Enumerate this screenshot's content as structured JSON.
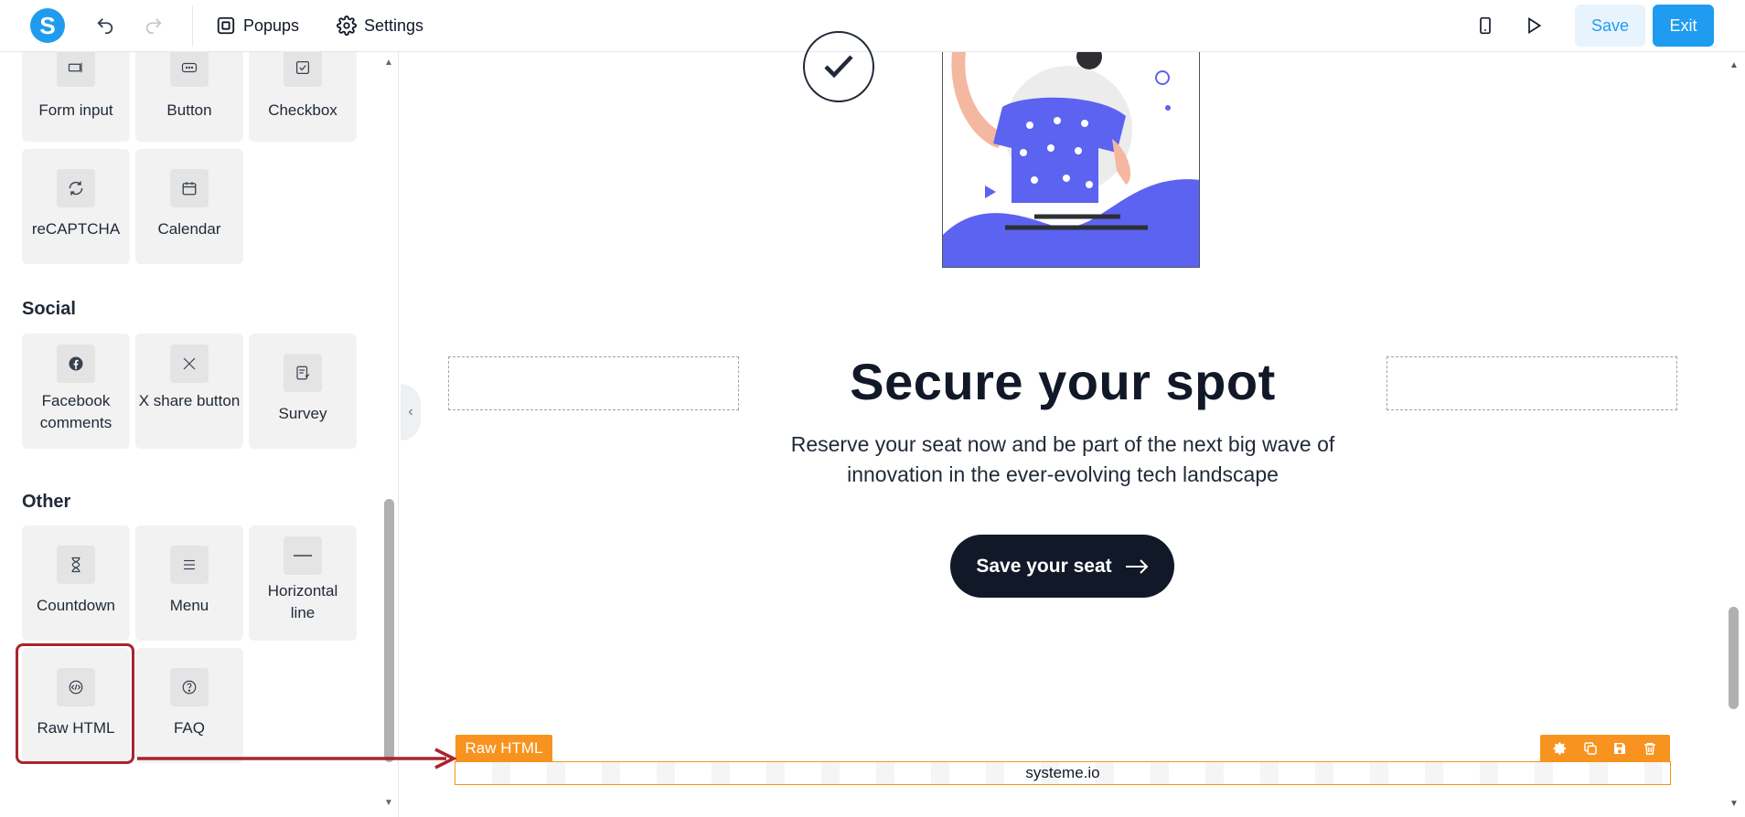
{
  "topbar": {
    "logo_letter": "S",
    "popups_label": "Popups",
    "settings_label": "Settings",
    "save_label": "Save",
    "exit_label": "Exit"
  },
  "sidebar": {
    "form_tiles": [
      {
        "label": "Form input",
        "icon": "form-input-icon"
      },
      {
        "label": "Button",
        "icon": "button-icon"
      },
      {
        "label": "Checkbox",
        "icon": "checkbox-icon"
      },
      {
        "label": "reCAPTCHA",
        "icon": "recaptcha-icon"
      },
      {
        "label": "Calendar",
        "icon": "calendar-icon"
      }
    ],
    "social_title": "Social",
    "social_tiles": [
      {
        "label": "Facebook comments",
        "icon": "facebook-icon"
      },
      {
        "label": "X share button",
        "icon": "x-icon"
      },
      {
        "label": "Survey",
        "icon": "survey-icon"
      }
    ],
    "other_title": "Other",
    "other_tiles": [
      {
        "label": "Countdown",
        "icon": "hourglass-icon"
      },
      {
        "label": "Menu",
        "icon": "menu-icon"
      },
      {
        "label": "Horizontal line",
        "icon": "horizontal-line-icon"
      },
      {
        "label": "Raw HTML",
        "icon": "code-icon"
      },
      {
        "label": "FAQ",
        "icon": "question-icon"
      }
    ]
  },
  "canvas": {
    "headline": "Secure your spot",
    "subtext": "Reserve your seat now and be part of the next big wave of innovation in the ever-evolving tech landscape",
    "cta_label": "Save your seat",
    "raw_html_label": "Raw HTML",
    "raw_html_content": "systeme.io"
  },
  "colors": {
    "accent": "#1f9cf0",
    "raw_html_orange": "#f7931e",
    "highlight_red": "#a8242d",
    "cta_dark": "#111827",
    "illustration_blue": "#5b63f0"
  }
}
